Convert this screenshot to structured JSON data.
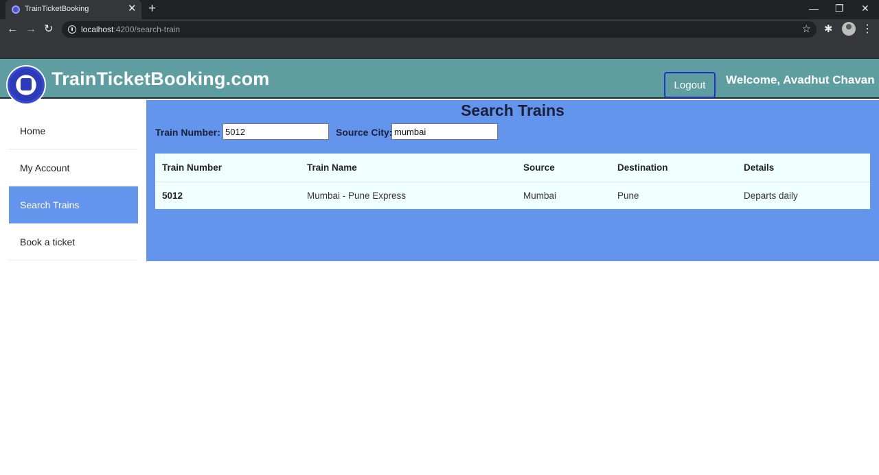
{
  "browser": {
    "tab_title": "TrainTicketBooking",
    "url_host": "localhost",
    "url_path": ":4200/search-train"
  },
  "header": {
    "brand": "TrainTicketBooking.com",
    "logout_label": "Logout",
    "welcome": "Welcome, Avadhut Chavan"
  },
  "sidebar": {
    "items": [
      {
        "label": "Home",
        "active": false
      },
      {
        "label": "My Account",
        "active": false
      },
      {
        "label": "Search Trains",
        "active": true
      },
      {
        "label": "Book a ticket",
        "active": false
      }
    ]
  },
  "main": {
    "title": "Search Trains",
    "train_number_label": "Train Number:",
    "train_number_value": "5012",
    "source_city_label": "Source City:",
    "source_city_value": "mumbai"
  },
  "table": {
    "headers": [
      "Train Number",
      "Train Name",
      "Source",
      "Destination",
      "Details"
    ],
    "rows": [
      [
        "5012",
        "Mumbai - Pune Express",
        "Mumbai",
        "Pune",
        "Departs daily"
      ]
    ]
  },
  "colors": {
    "header_bg": "#5f9ea0",
    "main_bg": "#6495ed",
    "table_bg": "#f0ffff"
  }
}
